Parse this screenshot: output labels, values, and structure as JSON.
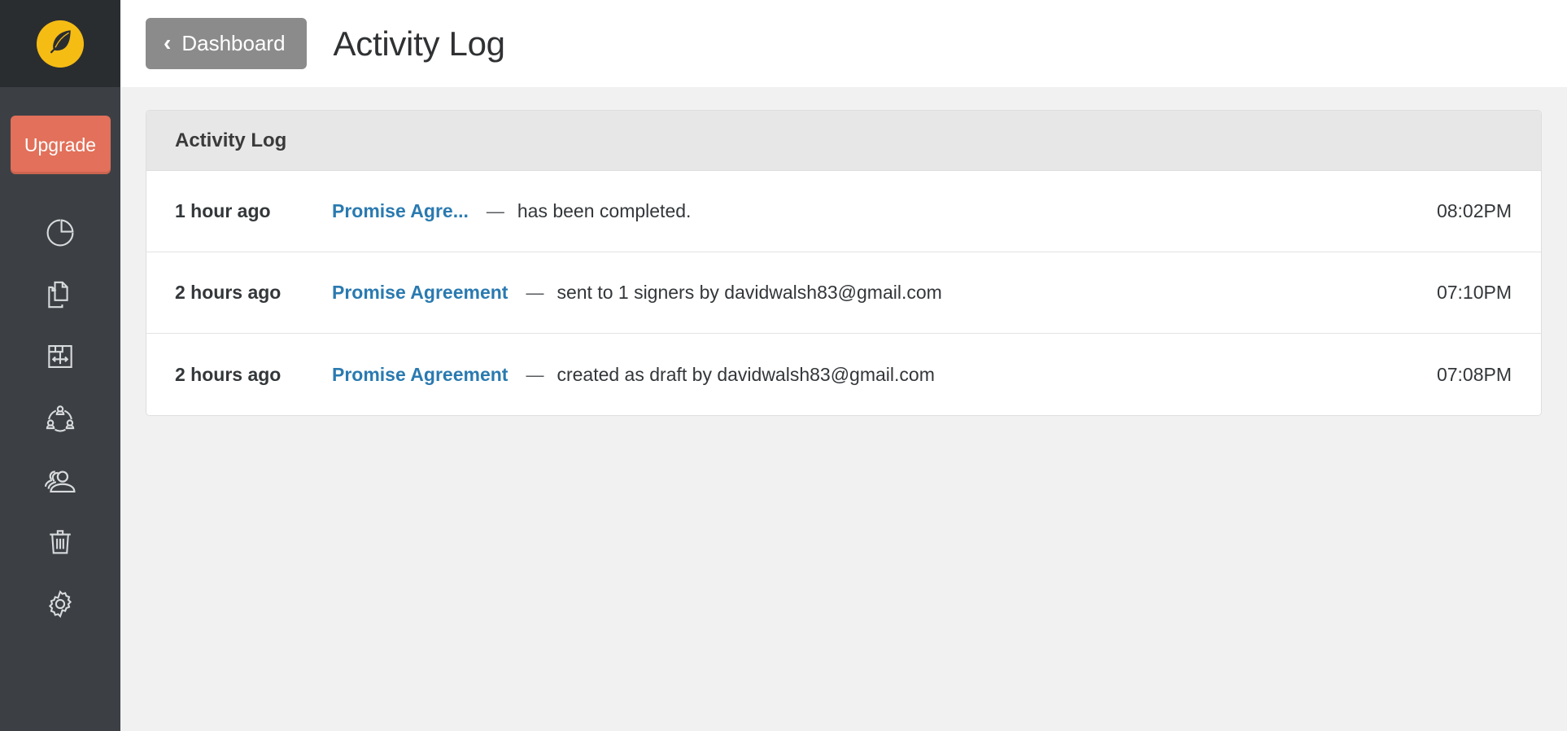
{
  "sidebar": {
    "logo": {
      "icon": "feather-quill-icon",
      "circle_color": "#f5bc14"
    },
    "upgrade": {
      "label": "Upgrade",
      "color": "#e2705a"
    },
    "items": [
      {
        "icon": "pie-chart-icon",
        "name": "sidebar-item-dashboard"
      },
      {
        "icon": "documents-icon",
        "name": "sidebar-item-documents"
      },
      {
        "icon": "document-transfer-icon",
        "name": "sidebar-item-templates"
      },
      {
        "icon": "team-network-icon",
        "name": "sidebar-item-team"
      },
      {
        "icon": "contacts-group-icon",
        "name": "sidebar-item-contacts"
      },
      {
        "icon": "trash-icon",
        "name": "sidebar-item-trash"
      },
      {
        "icon": "gear-icon",
        "name": "sidebar-item-settings"
      }
    ]
  },
  "topbar": {
    "back_label": "Dashboard",
    "back_icon": "chevron-left-icon",
    "title": "Activity Log"
  },
  "panel": {
    "title": "Activity Log",
    "rows": [
      {
        "when": "1 hour ago",
        "document": "Promise Agre...",
        "separator": "—",
        "description": "has been completed.",
        "time": "08:02PM"
      },
      {
        "when": "2 hours ago",
        "document": "Promise Agreement",
        "separator": "—",
        "description": "sent to 1 signers by davidwalsh83@gmail.com",
        "time": "07:10PM"
      },
      {
        "when": "2 hours ago",
        "document": "Promise Agreement",
        "separator": "—",
        "description": "created as draft by davidwalsh83@gmail.com",
        "time": "07:08PM"
      }
    ]
  },
  "colors": {
    "accent_link": "#2a7ab0",
    "upgrade": "#e2705a",
    "sidebar": "#3c4045",
    "sidebar_top": "#2a2d30",
    "logo_yellow": "#f5bc14",
    "page_bg": "#f1f1f1",
    "panel_header": "#e7e7e7"
  }
}
